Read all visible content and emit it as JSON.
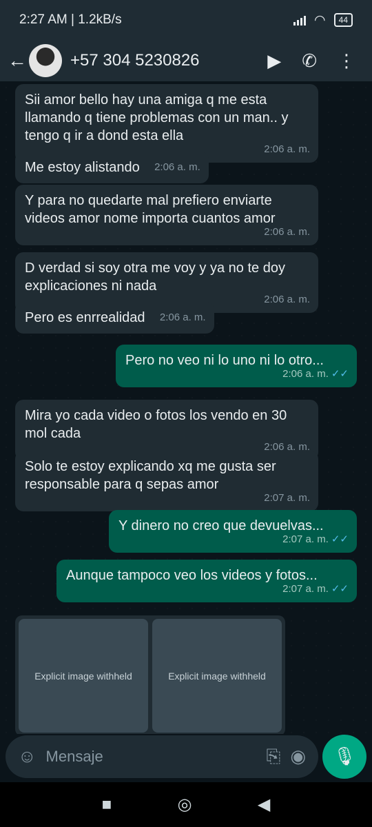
{
  "status_bar": {
    "time": "2:27 AM",
    "speed": "1.2kB/s",
    "battery": "44"
  },
  "header": {
    "contact": "+57 304 5230826",
    "icons": [
      "back-arrow-icon",
      "video-call-icon",
      "phone-icon",
      "more-icon"
    ]
  },
  "messages": [
    {
      "dir": "in",
      "text": "Sii amor bello hay una amiga q me esta llamando q tiene problemas con un man.. y tengo q ir a dond esta ella",
      "time": "2:06 a. m."
    },
    {
      "dir": "in",
      "text": "Me estoy alistando",
      "time": "2:06 a. m."
    },
    {
      "dir": "in",
      "text": "Y para no quedarte mal prefiero enviarte videos amor nome importa cuantos amor",
      "time": "2:06 a. m."
    },
    {
      "dir": "in",
      "text": "D verdad si soy otra me voy y ya no te doy explicaciones ni nada",
      "time": "2:06 a. m."
    },
    {
      "dir": "in",
      "text": "Pero es enrrealidad",
      "time": "2:06 a. m."
    },
    {
      "dir": "out",
      "text": "Pero no veo ni lo uno ni lo otro...",
      "time": "2:06 a. m."
    },
    {
      "dir": "in",
      "text": "Mira yo cada video o fotos los vendo en 30 mol cada",
      "time": "2:06 a. m."
    },
    {
      "dir": "in",
      "text": "Solo te estoy explicando xq me gusta ser responsable para q sepas amor",
      "time": "2:07 a. m."
    },
    {
      "dir": "out",
      "text": "Y dinero no creo que devuelvas...",
      "time": "2:07 a. m."
    },
    {
      "dir": "out",
      "text": "Aunque tampoco veo los videos y fotos...",
      "time": "2:07 a. m."
    }
  ],
  "media": {
    "withheld_label": "Explicit image withheld",
    "count": 2
  },
  "composer": {
    "placeholder": "Mensaje"
  },
  "colors": {
    "incoming": "#202c33",
    "outgoing": "#005c4b",
    "accent": "#00a884",
    "read_check": "#53bdeb"
  }
}
